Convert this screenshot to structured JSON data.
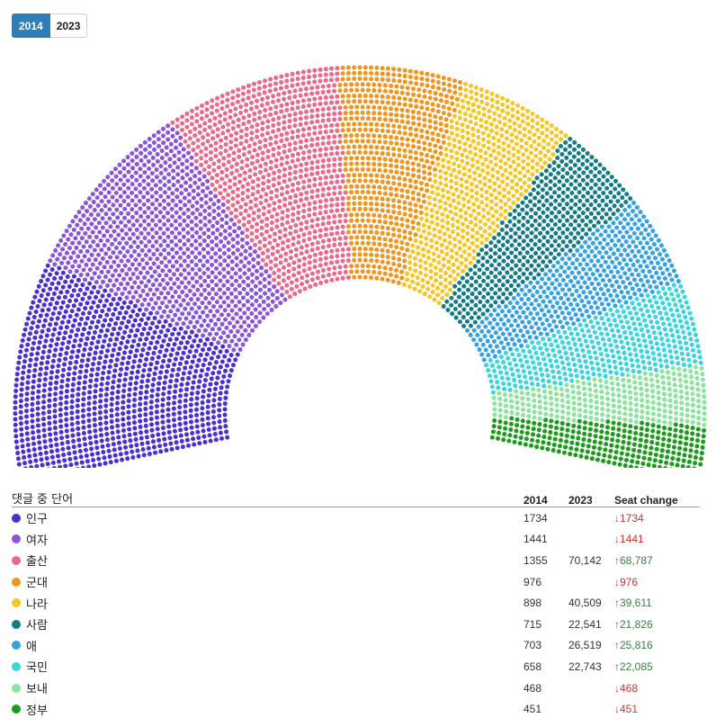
{
  "toggle": {
    "active_label": "2014",
    "inactive_label": "2023"
  },
  "table": {
    "header": {
      "name": "댓글 중 단어",
      "col1": "2014",
      "col2": "2023",
      "col3": "Seat change"
    }
  },
  "chart_data": {
    "type": "parliament",
    "selected_year": "2014",
    "series": [
      {
        "name": "인구",
        "color": "#4b2fd0",
        "y2014": "1734",
        "y2023": "",
        "change": "1734",
        "direction": "down",
        "seats": 1734
      },
      {
        "name": "여자",
        "color": "#8b55d9",
        "y2014": "1441",
        "y2023": "",
        "change": "1441",
        "direction": "down",
        "seats": 1441
      },
      {
        "name": "출산",
        "color": "#ea6a8c",
        "y2014": "1355",
        "y2023": "70,142",
        "change": "68,787",
        "direction": "up",
        "seats": 1355
      },
      {
        "name": "군대",
        "color": "#f0961e",
        "y2014": "976",
        "y2023": "",
        "change": "976",
        "direction": "down",
        "seats": 976
      },
      {
        "name": "나라",
        "color": "#f5c725",
        "y2014": "898",
        "y2023": "40,509",
        "change": "39,611",
        "direction": "up",
        "seats": 898
      },
      {
        "name": "사람",
        "color": "#137c84",
        "y2014": "715",
        "y2023": "22,541",
        "change": "21,826",
        "direction": "up",
        "seats": 715
      },
      {
        "name": "애",
        "color": "#35a3e3",
        "y2014": "703",
        "y2023": "26,519",
        "change": "25,816",
        "direction": "up",
        "seats": 703
      },
      {
        "name": "국민",
        "color": "#3bd6dc",
        "y2014": "658",
        "y2023": "22,743",
        "change": "22,085",
        "direction": "up",
        "seats": 658
      },
      {
        "name": "보내",
        "color": "#8ee39e",
        "y2014": "468",
        "y2023": "",
        "change": "468",
        "direction": "down",
        "seats": 468
      },
      {
        "name": "정부",
        "color": "#1b9c1b",
        "y2014": "451",
        "y2023": "",
        "change": "451",
        "direction": "down",
        "seats": 451
      }
    ]
  }
}
